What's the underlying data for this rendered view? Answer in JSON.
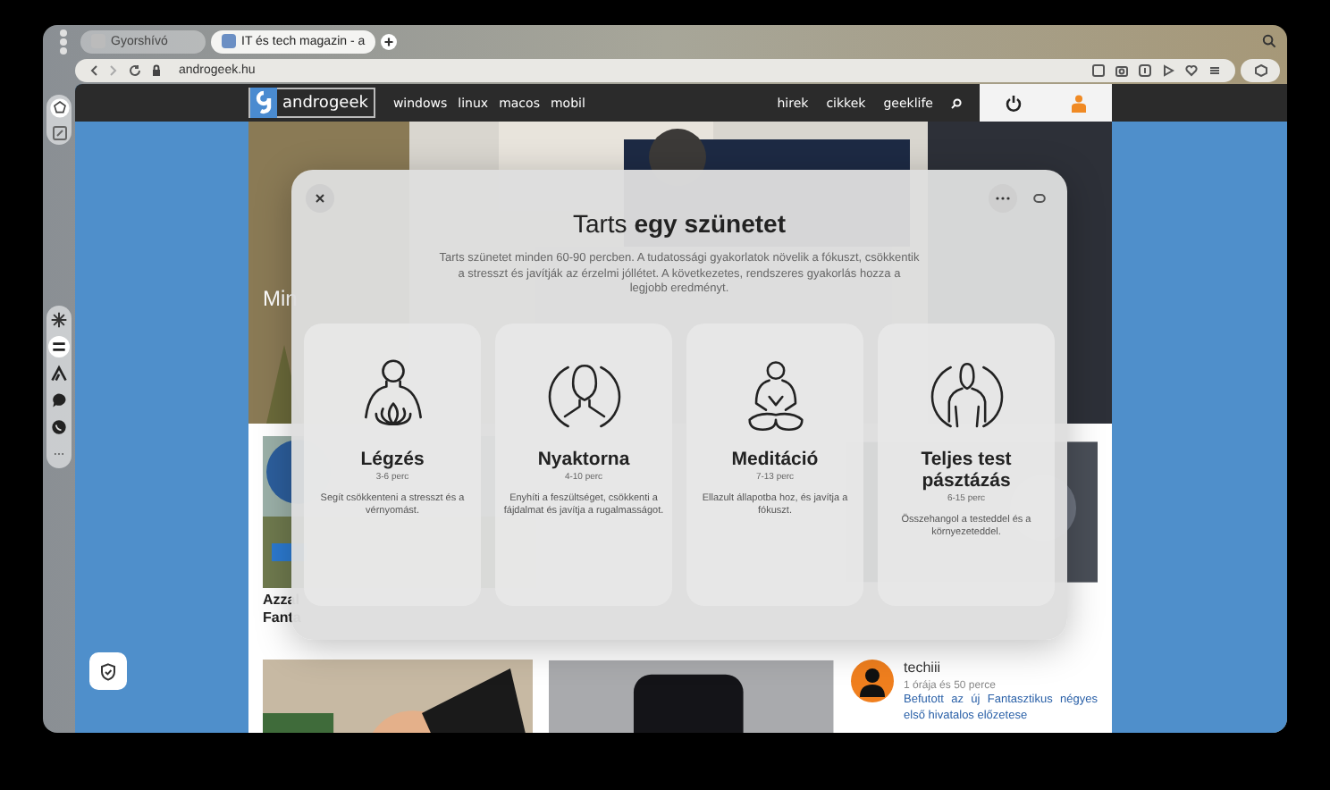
{
  "browser": {
    "tabs": [
      {
        "label": "Gyorshívó",
        "selected": false
      },
      {
        "label": "IT és tech magazin - a",
        "selected": true
      }
    ],
    "address": "androgeek.hu"
  },
  "sidebar": {
    "panels": [
      {
        "kind": "sparkle",
        "selected": false
      },
      {
        "kind": "sliders",
        "selected": true
      },
      {
        "kind": "peak",
        "selected": false
      },
      {
        "kind": "chat",
        "selected": false
      },
      {
        "kind": "phone",
        "selected": false
      },
      {
        "kind": "more",
        "selected": false
      }
    ]
  },
  "site": {
    "logo": "androgeek",
    "nav_left": [
      "windows",
      "linux",
      "macos",
      "mobil"
    ],
    "nav_right": [
      "hirek",
      "cikkek",
      "geeklife"
    ],
    "hero": {
      "title": "Min"
    },
    "article": {
      "title": "Azzal Fanta"
    },
    "comment": {
      "author": "techiii",
      "time": "1 órája és 50 perce",
      "text": "Befutott az új Fantasztikus négyes első hivatalos előzetese"
    }
  },
  "modal": {
    "title": "Tarts **egy szünetet**",
    "description": "Tarts szünetet minden 60-90 percben. A tudatossági gyakorlatok növelik a fókuszt, csökkentik a stresszt és javítják az érzelmi jóllétet. A következetes, rendszeres gyakorlás hozza a legjobb eredményt.",
    "options": [
      {
        "kind": "breathing",
        "name": "Légzés",
        "duration": "3-6 perc",
        "description": "Segít csökkenteni a stresszt és a vérnyomást."
      },
      {
        "kind": "neck",
        "name": "Nyaktorna",
        "duration": "4-10 perc",
        "description": "Enyhíti a feszültséget, csökkenti a fájdalmat és javítja a rugalmasságot."
      },
      {
        "kind": "meditation",
        "name": "Meditáció",
        "duration": "7-13 perc",
        "description": "Ellazult állapotba hoz, és javítja a fókuszt."
      },
      {
        "kind": "bodyscan",
        "name": "Teljes test pásztázás",
        "duration": "6-15 perc",
        "description": "Összehangol a testeddel és a környezeteddel."
      }
    ]
  }
}
